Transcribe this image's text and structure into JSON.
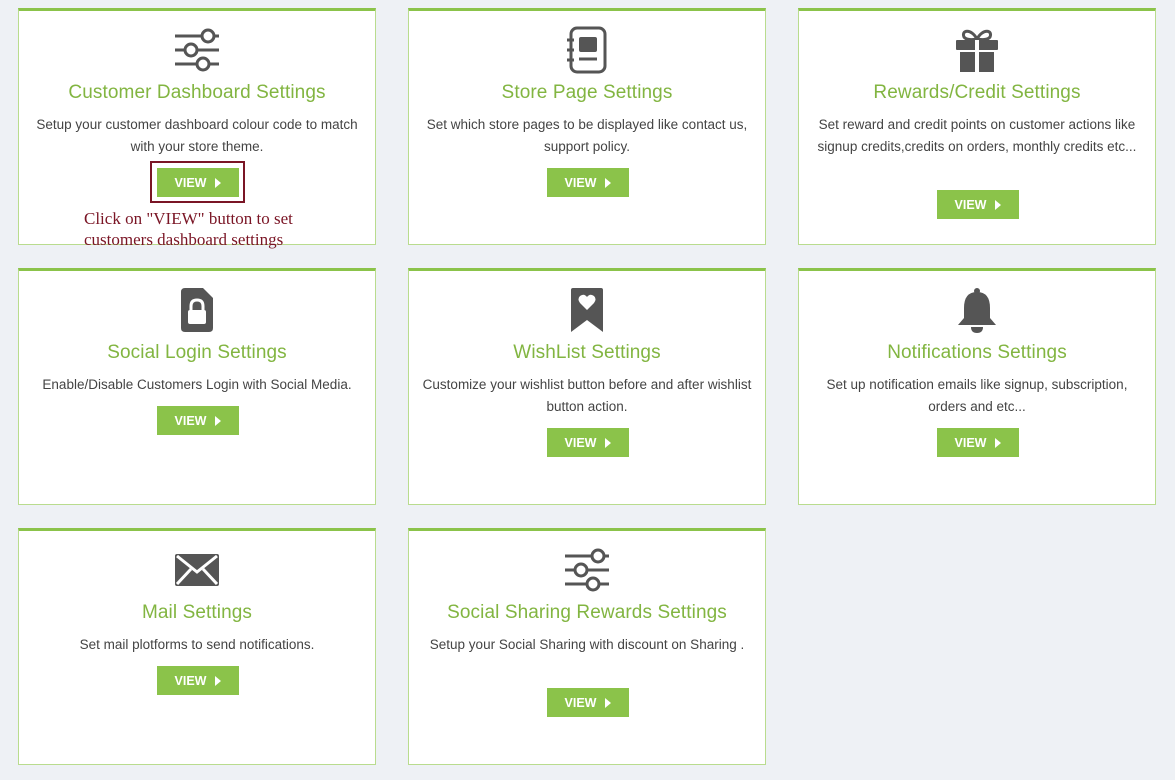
{
  "accent_color": "#8bc34a",
  "title_color": "#82b541",
  "cards": [
    {
      "icon": "sliders-icon",
      "title": "Customer Dashboard Settings",
      "description": "Setup your customer dashboard colour code to match with your store theme.",
      "button": "VIEW"
    },
    {
      "icon": "store-page-icon",
      "title": "Store Page Settings",
      "description": "Set which store pages to be displayed like contact us, support policy.",
      "button": "VIEW"
    },
    {
      "icon": "gift-icon",
      "title": "Rewards/Credit Settings",
      "description": "Set reward and credit points on customer actions like signup credits,credits on orders, monthly credits etc...",
      "button": "VIEW"
    },
    {
      "icon": "lock-document-icon",
      "title": "Social Login Settings",
      "description": "Enable/Disable Customers Login with Social Media.",
      "button": "VIEW"
    },
    {
      "icon": "heart-bookmark-icon",
      "title": "WishList Settings",
      "description": "Customize your wishlist button before and after wishlist button action.",
      "button": "VIEW"
    },
    {
      "icon": "bell-icon",
      "title": "Notifications Settings",
      "description": "Set up notification emails like signup, subscription, orders and etc...",
      "button": "VIEW"
    },
    {
      "icon": "envelope-icon",
      "title": "Mail Settings",
      "description": "Set mail plotforms to send notifications.",
      "button": "VIEW"
    },
    {
      "icon": "sliders-icon",
      "title": "Social Sharing Rewards Settings",
      "description": "Setup your Social Sharing with discount on Sharing .",
      "button": "VIEW"
    }
  ],
  "annotation": {
    "text": "Click on \"VIEW\" button to set customers dashboard settings",
    "color": "#7a1525"
  }
}
